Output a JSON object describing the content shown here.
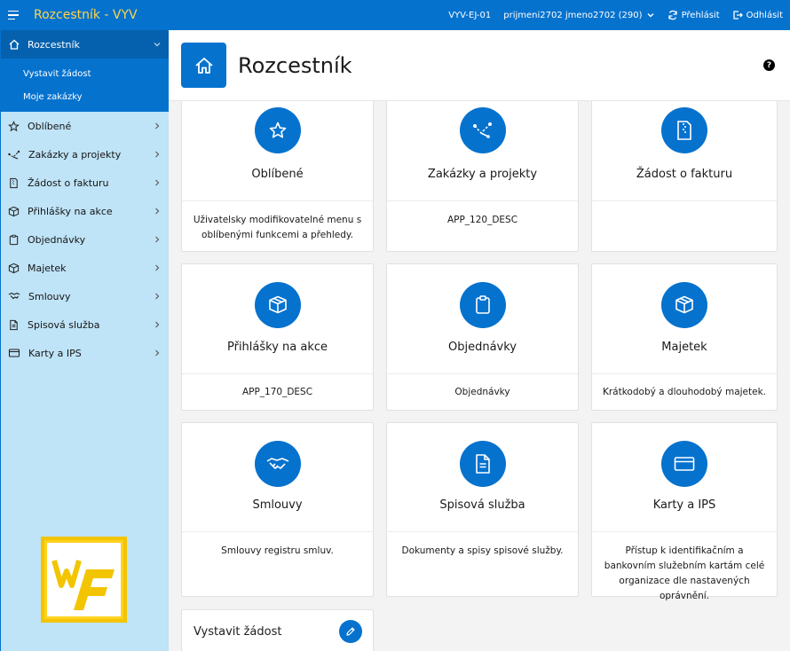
{
  "header": {
    "app_title": "Rozcestník - VYV",
    "env": "VYV-EJ-01",
    "user": "prijmeni2702 jmeno2702 (290)",
    "refresh_label": "Přehlásit",
    "logout_label": "Odhlásit"
  },
  "sidebar": {
    "active": {
      "label": "Rozcestník",
      "icon": "home-icon"
    },
    "sub_items": [
      {
        "label": "Vystavit žádost"
      },
      {
        "label": "Moje zakázky"
      }
    ],
    "items": [
      {
        "label": "Oblíbené",
        "icon": "star-icon"
      },
      {
        "label": "Zakázky a projekty",
        "icon": "route-icon"
      },
      {
        "label": "Žádost o fakturu",
        "icon": "file-zip-icon"
      },
      {
        "label": "Přihlášky na akce",
        "icon": "box-icon"
      },
      {
        "label": "Objednávky",
        "icon": "clipboard-icon"
      },
      {
        "label": "Majetek",
        "icon": "box-icon"
      },
      {
        "label": "Smlouvy",
        "icon": "handshake-icon"
      },
      {
        "label": "Spisová služba",
        "icon": "document-icon"
      },
      {
        "label": "Karty a IPS",
        "icon": "card-icon"
      }
    ]
  },
  "page": {
    "title": "Rozcestník",
    "help": "?"
  },
  "cards": [
    {
      "title": "Oblíbené",
      "desc": "Uživatelsky modifikovatelné menu s oblíbenými funkcemi a přehledy.",
      "icon": "star-icon"
    },
    {
      "title": "Zakázky a projekty",
      "desc": "APP_120_DESC",
      "icon": "route-icon"
    },
    {
      "title": "Žádost o fakturu",
      "desc": "",
      "icon": "file-zip-icon"
    },
    {
      "title": "Přihlášky na akce",
      "desc": "APP_170_DESC",
      "icon": "box-icon"
    },
    {
      "title": "Objednávky",
      "desc": "Objednávky",
      "icon": "clipboard-icon"
    },
    {
      "title": "Majetek",
      "desc": "Krátkodobý a dlouhodobý majetek.",
      "icon": "box-icon"
    },
    {
      "title": "Smlouvy",
      "desc": "Smlouvy registru smluv.",
      "icon": "handshake-icon"
    },
    {
      "title": "Spisová služba",
      "desc": "Dokumenty a spisy spisové služby.",
      "icon": "document-icon"
    },
    {
      "title": "Karty a IPS",
      "desc": "Přístup k identifikačním a bankovním služebním kartám celé organizace dle nastavených oprávnění.",
      "icon": "card-icon"
    }
  ],
  "request_card": {
    "label": "Vystavit žádost",
    "icon": "pencil-icon"
  },
  "colors": {
    "brand": "#0572ce",
    "title_accent": "#ffd54a",
    "sidebar_bg": "#bfe3f7",
    "logo_yellow": "#ffd21f"
  }
}
